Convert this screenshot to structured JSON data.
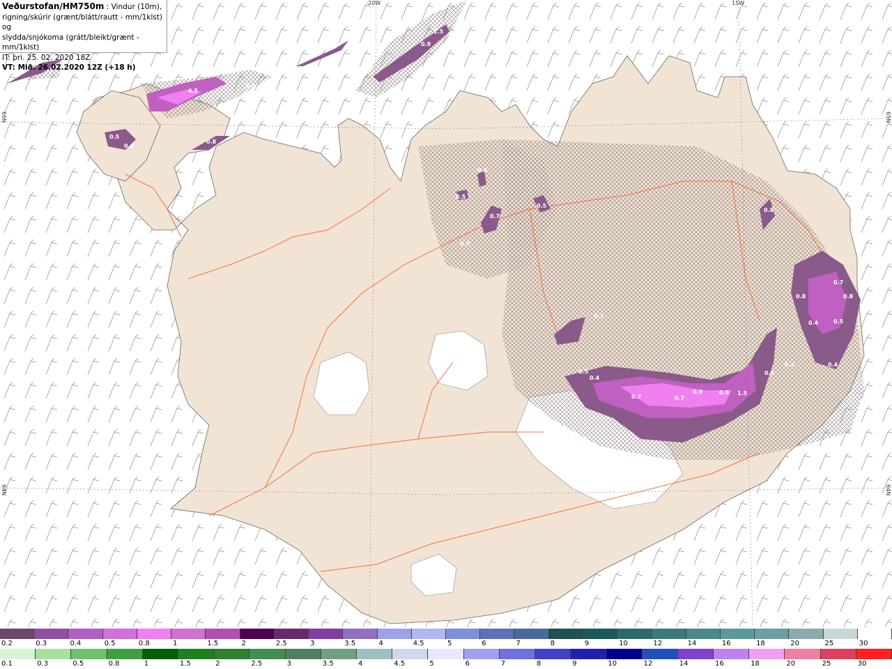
{
  "header": {
    "brand": "Veðurstofan/HM750m",
    "description_1": " : Vindur (10m),",
    "description_2": "rigning/skúrir (grænt/blátt/rautt - mm/1klst) og",
    "description_3": "slydda/snjókoma (grátt/bleikt/grænt - mm/1klst)",
    "issue_time": "IT: þri. 25. 02. 2020 18Z",
    "valid_time": "VT: Mið. 26.02.2020 12Z (+18 h)"
  },
  "coords": {
    "top_20w": "20W",
    "top_15w": "15W",
    "left_66n": "66N",
    "left_64n": "64N",
    "right_65n": "65N",
    "right_64n": "64N"
  },
  "contour_labels": [
    "0.5",
    "0.4",
    "4.5",
    "0.3",
    "0.8",
    "0.9",
    "1.5",
    "0.6",
    "0.5",
    "0.7",
    "0.3",
    "0.5",
    "0.8",
    "1.5",
    "0.4",
    "0.7",
    "0.9",
    "0.7",
    "0.6",
    "0.5",
    "0.8",
    "0.4",
    "0.4",
    "0.5",
    "0.7",
    "0.9",
    "0.3",
    "0.4",
    "0.8"
  ],
  "colors": {
    "land": "#f2e4d4",
    "glacier": "#ffffff",
    "ocean": "#ffffff",
    "roads": "#f07040",
    "snow_light": "#8a5a8a",
    "snow_mid": "#c060c0",
    "snow_high": "#f080f0",
    "hatch": "#8a7a7a"
  },
  "legend_sleet_snow": {
    "labels": [
      "0.2",
      "0.3",
      "0.4",
      "0.5",
      "0.8",
      "1",
      "1.5",
      "2",
      "2.5",
      "3",
      "3.5",
      "4",
      "4.5",
      "5",
      "6",
      "7",
      "8",
      "9",
      "10",
      "12",
      "14",
      "16",
      "18",
      "20",
      "25",
      "30"
    ],
    "colors": [
      "#6a4a6a",
      "#9050a0",
      "#b060c0",
      "#d070d8",
      "#f080f0",
      "#d070d0",
      "#b050b0",
      "#500050",
      "#6a2a6a",
      "#8040a0",
      "#9070c0",
      "#a0a0e8",
      "#b0b8f0",
      "#8090d8",
      "#6070b8",
      "#4a6a9a",
      "#205050",
      "#1a5a5a",
      "#2a6a6a",
      "#3a7a7a",
      "#4a8a8a",
      "#5a9a9a",
      "#6aa0a0",
      "#8aacac",
      "#c8d8d8",
      "#ffffff"
    ]
  },
  "legend_rain": {
    "labels": [
      "0.1",
      "0.3",
      "0.5",
      "0.8",
      "1",
      "1.5",
      "2",
      "2.5",
      "3",
      "3.5",
      "4",
      "4.5",
      "5",
      "6",
      "7",
      "8",
      "9",
      "10",
      "12",
      "14",
      "16",
      "18",
      "20",
      "25",
      "30"
    ],
    "colors": [
      "#d8f5d8",
      "#a8e0a0",
      "#70c070",
      "#40a040",
      "#006000",
      "#208020",
      "#308030",
      "#409050",
      "#508060",
      "#70a080",
      "#a0c0c0",
      "#d0d8f0",
      "#e8e8ff",
      "#a0a0f0",
      "#7070e0",
      "#4040c8",
      "#2020b0",
      "#000090",
      "#2050c0",
      "#8040d0",
      "#c080f0",
      "#f0a0f0",
      "#f080a0",
      "#e04060",
      "#ff2020"
    ]
  }
}
